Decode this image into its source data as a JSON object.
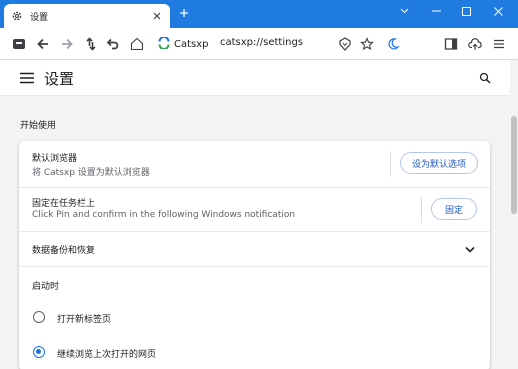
{
  "tab": {
    "title": "设置"
  },
  "toolbar": {
    "site_name": "Catsxp",
    "url": "catsxp://settings"
  },
  "settings": {
    "title": "设置",
    "section_title": "开始使用",
    "default_browser": {
      "title": "默认浏览器",
      "subtitle": "将 Catsxp 设置为默认浏览器",
      "button": "设为默认选项"
    },
    "pin_taskbar": {
      "title": "固定在任务栏上",
      "subtitle": "Click Pin and confirm in the following Windows notification",
      "button": "固定"
    },
    "backup": {
      "title": "数据备份和恢复"
    },
    "startup": {
      "title": "启动时",
      "options": [
        {
          "label": "打开新标签页",
          "selected": false
        },
        {
          "label": "继续浏览上次打开的网页",
          "selected": true
        }
      ]
    }
  },
  "colors": {
    "titlebar": "#1f7be0",
    "accent": "#1a73e8",
    "button_text": "#1a56c9"
  },
  "icons": {
    "tab": "gear-icon",
    "tab_close": "close-icon",
    "new_tab": "plus-icon",
    "window": [
      "chevron-down-icon",
      "minimize-icon",
      "maximize-icon",
      "window-close-icon"
    ],
    "toolbar": [
      "wallet-icon",
      "back-icon",
      "forward-icon",
      "reload-icon",
      "undo-icon",
      "home-icon",
      "catsxp-logo-icon",
      "shield-icon",
      "star-icon",
      "moon-icon",
      "sidebar-icon",
      "upload-icon",
      "menu-icon"
    ],
    "settings": [
      "hamburger-icon",
      "search-icon",
      "chevron-down-icon"
    ]
  }
}
